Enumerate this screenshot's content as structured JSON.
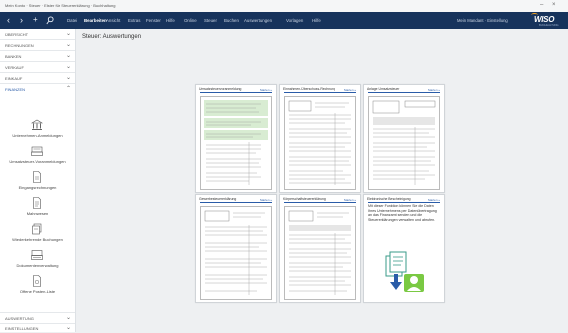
{
  "window": {
    "title": "Mein Konto · Steuer · Elster für Steuererklärung · Buchhaltung"
  },
  "menubar": {
    "items": [
      "Datei",
      "Bearbeiten",
      "Ansicht",
      "Extras",
      "Fenster",
      "Hilfe",
      "Online",
      "Steuer",
      "Buchen",
      "Auswertungen",
      "Vorlagen",
      "Hilfe"
    ],
    "active_index": 1,
    "user": "Mein Mandant · Einstellung",
    "logo_main": "WISO",
    "logo_sub": "BUCHHALTUNG"
  },
  "sidebar": {
    "sections_top": [
      {
        "label": "Übersicht",
        "chevron": "⌄"
      },
      {
        "label": "Rechnungen",
        "chevron": "⌄"
      },
      {
        "label": "Banken",
        "chevron": "⌄"
      },
      {
        "label": "Verkauf",
        "chevron": "⌄"
      },
      {
        "label": "Einkauf",
        "chevron": "⌄"
      },
      {
        "label": "Finanzen",
        "chevron": "⌃"
      }
    ],
    "items": [
      {
        "label": "Unternehmen-Anmeldungen",
        "icon": "bank-icon"
      },
      {
        "label": "Umsatzsteuer-Voranmeldungen",
        "icon": "register-icon"
      },
      {
        "label": "Eingangsrechnungen",
        "icon": "document-icon"
      },
      {
        "label": "Mahnwesen",
        "icon": "document-icon"
      },
      {
        "label": "Wiederkehrende Buchungen",
        "icon": "stack-icon"
      },
      {
        "label": "Dokumentenverwaltung",
        "icon": "register-icon"
      },
      {
        "label": "Offene Posten-Liste",
        "icon": "document-icon"
      }
    ],
    "sections_bottom": [
      {
        "label": "Auswertung",
        "chevron": "⌄"
      },
      {
        "label": "Einstellungen",
        "chevron": "⌄"
      }
    ]
  },
  "content": {
    "title": "Steuer: Auswertungen",
    "cards": [
      {
        "title": "Umsatzsteuervoranmeldung",
        "link": "Starten »"
      },
      {
        "title": "Einnahmen-Überschuss-Rechnung",
        "link": "Starten »"
      },
      {
        "title": "Anlage Umsatzsteuer",
        "link": "Starten »"
      },
      {
        "title": "Gewerbesteuererklärung",
        "link": "Starten »"
      },
      {
        "title": "Körperschaftsteuererklärung",
        "link": "Starten »"
      },
      {
        "title": "Elektronische Bescheinigung",
        "link": "Starten »"
      }
    ],
    "card6_desc": "Mit dieser Funktion können Sie die Daten Ihres Unternehmens per Datenübertragung an das Finanzamt senden und die Steuererklärungen verwalten und abrufen."
  },
  "colors": {
    "menubar": "#17335c",
    "accent": "#2a5ca8",
    "green": "#d8ecd2"
  }
}
